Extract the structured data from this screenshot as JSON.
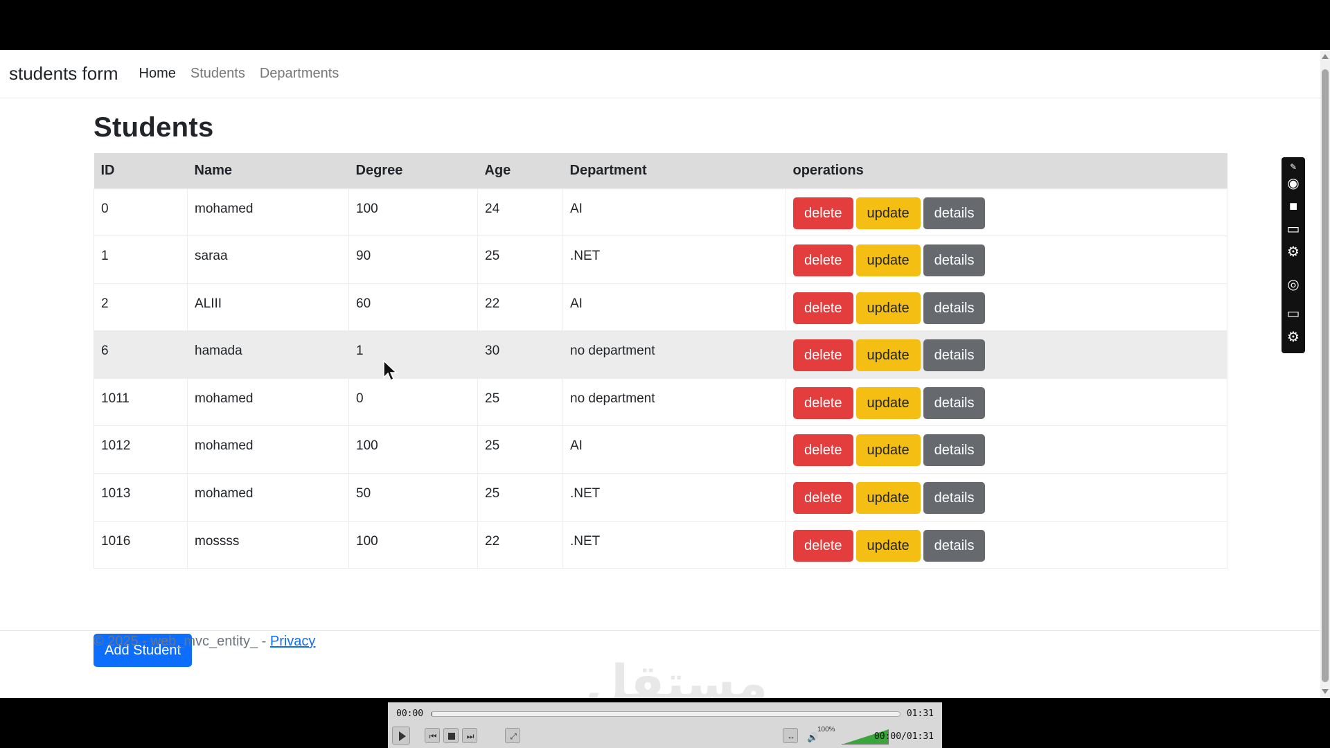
{
  "navbar": {
    "brand": "students form",
    "links": [
      {
        "label": "Home",
        "active": true
      },
      {
        "label": "Students",
        "active": false
      },
      {
        "label": "Departments",
        "active": false
      }
    ]
  },
  "main": {
    "title": "Students",
    "table": {
      "headers": [
        "ID",
        "Name",
        "Degree",
        "Age",
        "Department",
        "operations"
      ],
      "rows": [
        {
          "id": "0",
          "name": "mohamed",
          "degree": "100",
          "age": "24",
          "department": "AI"
        },
        {
          "id": "1",
          "name": "saraa",
          "degree": "90",
          "age": "25",
          "department": ".NET"
        },
        {
          "id": "2",
          "name": "ALIII",
          "degree": "60",
          "age": "22",
          "department": "AI"
        },
        {
          "id": "6",
          "name": "hamada",
          "degree": "1",
          "age": "30",
          "department": "no department"
        },
        {
          "id": "1011",
          "name": "mohamed",
          "degree": "0",
          "age": "25",
          "department": "no department"
        },
        {
          "id": "1012",
          "name": "mohamed",
          "degree": "100",
          "age": "25",
          "department": "AI"
        },
        {
          "id": "1013",
          "name": "mohamed",
          "degree": "50",
          "age": "25",
          "department": ".NET"
        },
        {
          "id": "1016",
          "name": "mossss",
          "degree": "100",
          "age": "22",
          "department": ".NET"
        }
      ],
      "buttons": {
        "delete": "delete",
        "update": "update",
        "details": "details"
      }
    },
    "add_button": "Add Student"
  },
  "footer": {
    "text": "© 2025 - web_mvc_entity_ - ",
    "privacy_link": "Privacy"
  },
  "watermark": "مستقل",
  "player": {
    "current_time": "00:00",
    "total_time": "01:31",
    "time_display": "00:00/01:31",
    "volume": "100%",
    "progress": 0.002
  },
  "colors": {
    "delete": "#e33d3d",
    "update": "#f4be12",
    "details": "#666a6e",
    "primary": "#0d6efd"
  },
  "icons": [
    "play-icon",
    "previous-icon",
    "stop-icon",
    "next-icon",
    "fullscreen-icon",
    "volume-icon",
    "camera-icon",
    "video-icon",
    "window-icon",
    "gear-icon",
    "webcam-icon"
  ]
}
